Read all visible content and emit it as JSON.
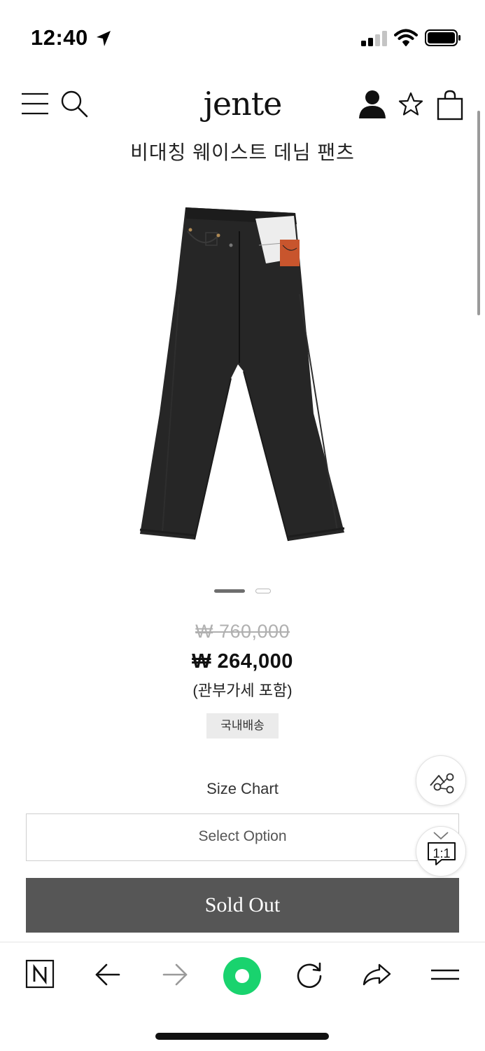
{
  "status_bar": {
    "time": "12:40"
  },
  "header": {
    "logo": "jente",
    "icons": [
      "menu-icon",
      "search-icon",
      "account-icon",
      "star-icon",
      "shopping-bag-icon"
    ]
  },
  "product": {
    "title": "비대칭 웨이스트 데님 팬츠",
    "image_subject": "black denim jeans",
    "slides_total": 2,
    "slide_active": 1,
    "original_price": "₩ 760,000",
    "sale_price": "₩ 264,000",
    "tax_note": "(관부가세 포함)",
    "shipping_badge": "국내배송"
  },
  "options": {
    "size_chart_label": "Size Chart",
    "select_placeholder": "Select Option",
    "sold_out_label": "Sold Out"
  },
  "floating": {
    "chat_label": "1:1",
    "icons": [
      "share-icon",
      "chat-icon"
    ]
  },
  "browser_toolbar": {
    "icons": [
      "naver-home-icon",
      "back-icon",
      "forward-icon",
      "green-dot-icon",
      "reload-icon",
      "share-icon",
      "menu-icon"
    ]
  },
  "colors": {
    "sold_out_bg": "#565656",
    "badge_bg": "#ebebeb",
    "green_accent": "#19d36e"
  }
}
